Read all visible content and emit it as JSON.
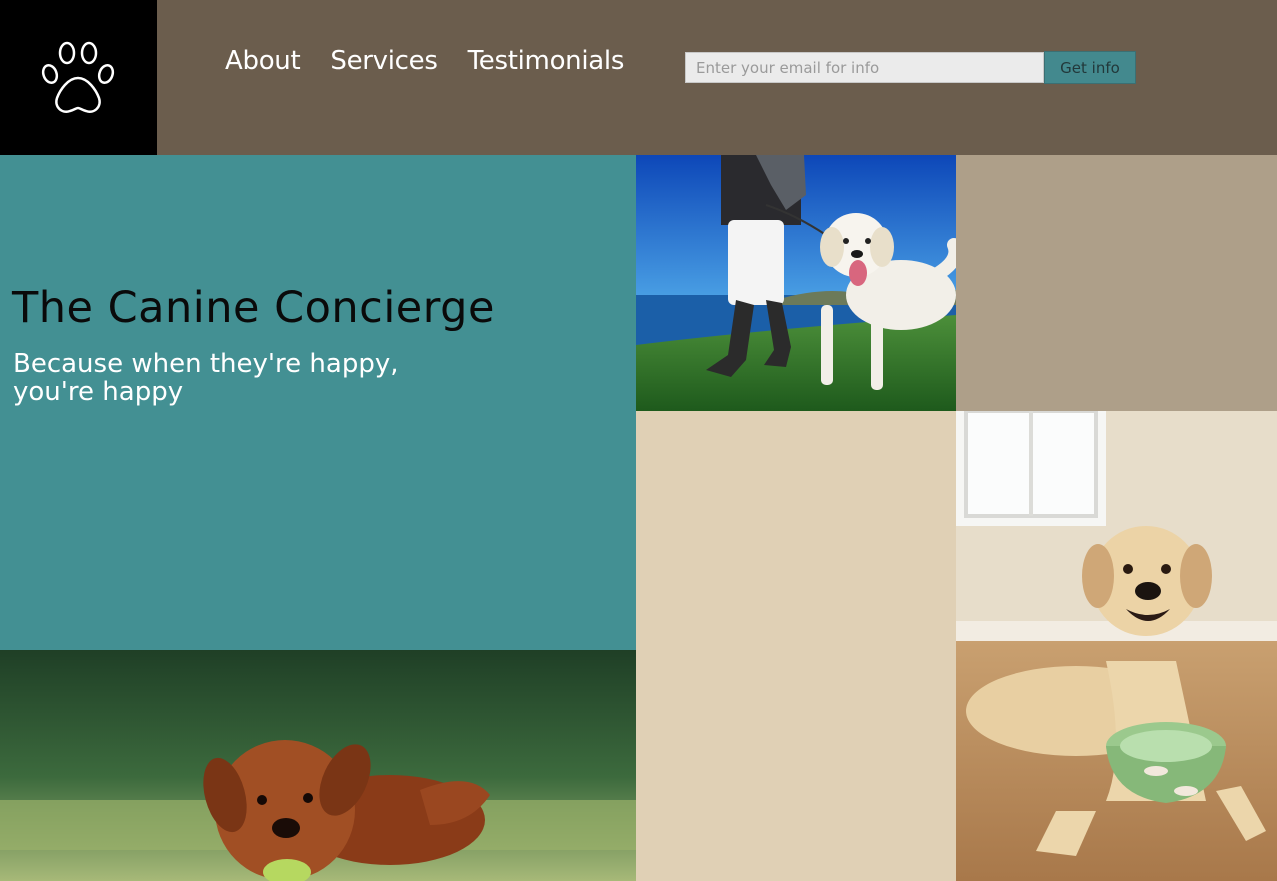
{
  "brand": {
    "logo_icon": "paw-icon"
  },
  "nav": {
    "items": [
      {
        "label": "About"
      },
      {
        "label": "Services"
      },
      {
        "label": "Testimonials"
      }
    ]
  },
  "signup": {
    "placeholder": "Enter your email for info",
    "value": "",
    "button_label": "Get info"
  },
  "hero": {
    "title": "The Canine Concierge",
    "subtitle": "Because when they're happy, you're happy"
  },
  "colors": {
    "header_bg": "#6b5d4d",
    "logo_bg": "#000000",
    "hero_bg": "#439093",
    "accent_button": "#43898e",
    "tile_taupe": "#ae9f89",
    "tile_beige": "#e0d0b5"
  }
}
